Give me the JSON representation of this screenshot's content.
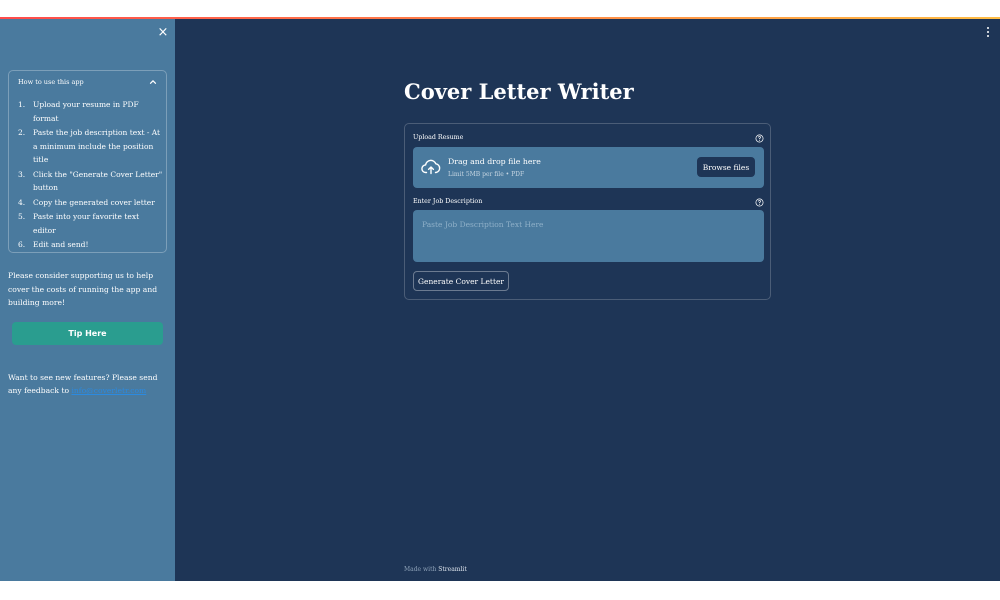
{
  "sidebar": {
    "close_label": "×",
    "expander": {
      "title": "How to use this app",
      "steps": [
        {
          "num": "1.",
          "text": "Upload your resume in PDF format"
        },
        {
          "num": "2.",
          "text": "Paste the job description text - At a minimum include the position title"
        },
        {
          "num": "3.",
          "text": "Click the \"Generate Cover Letter\" button"
        },
        {
          "num": "4.",
          "text": "Copy the generated cover letter"
        },
        {
          "num": "5.",
          "text": "Paste into your favorite text editor"
        },
        {
          "num": "6.",
          "text": "Edit and send!"
        }
      ]
    },
    "support_text": "Please consider supporting us to help cover the costs of running the app and building more!",
    "tip_button": "Tip Here",
    "feature_text": "Want to see new features? Please send any feedback to",
    "feedback_link": "info@coverletr.com"
  },
  "main": {
    "title": "Cover Letter Writer",
    "upload": {
      "label": "Upload Resume",
      "drop_text": "Drag and drop file here",
      "limit_text": "Limit 5MB per file • PDF",
      "browse_button": "Browse files"
    },
    "job_description": {
      "label": "Enter Job Description",
      "placeholder": "Paste Job Description Text Here"
    },
    "generate_button": "Generate Cover Letter"
  },
  "footer": {
    "prefix": "Made with",
    "brand": "Streamlit"
  },
  "colors": {
    "main_bg": "#1e3556",
    "sidebar_bg": "#4a7a9e",
    "tip_button_bg": "#2a9d8f",
    "link": "#2b8ae0"
  }
}
